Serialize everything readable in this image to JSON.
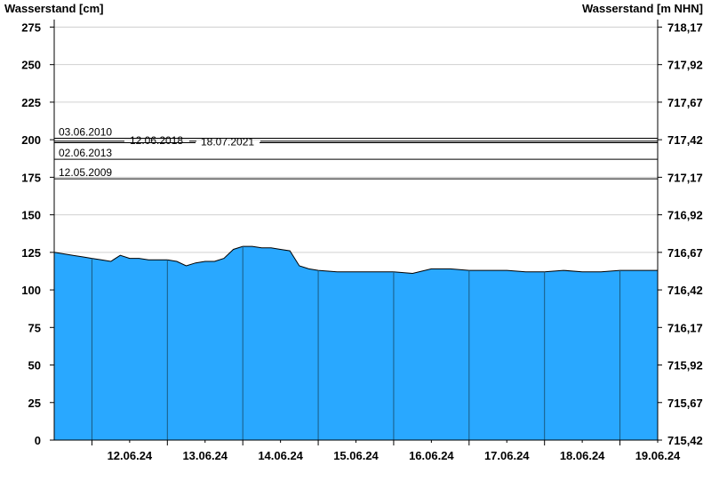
{
  "chart_data": {
    "type": "area",
    "ylabel_left": "Wasserstand [cm]",
    "ylabel_right": "Wasserstand [m NHN]",
    "ylim": [
      0,
      280
    ],
    "y_ticks_left": [
      0,
      25,
      50,
      75,
      100,
      125,
      150,
      175,
      200,
      225,
      250,
      275
    ],
    "y_ticks_right_labels": [
      "715,42",
      "715,67",
      "715,92",
      "716,17",
      "716,42",
      "716,67",
      "716,92",
      "717,17",
      "717,42",
      "717,67",
      "717,92",
      "718,17"
    ],
    "x_range": [
      "11.06.24 12:00",
      "19.06.24 12:00"
    ],
    "x_tick_labels": [
      "12.06.24",
      "13.06.24",
      "14.06.24",
      "15.06.24",
      "16.06.24",
      "17.06.24",
      "18.06.24",
      "19.06.24"
    ],
    "grid": true,
    "fill_color": "#29a8ff",
    "outline_color": "#000000",
    "day_separator_color": "#1a5a80",
    "reference_levels": [
      {
        "label": "03.06.2010",
        "value": 201
      },
      {
        "label": "12.06.2018",
        "value": 199
      },
      {
        "label": "18.07.2021",
        "value": 198
      },
      {
        "label": "02.06.2013",
        "value": 187
      },
      {
        "label": "12.05.2009",
        "value": 174
      }
    ],
    "series": [
      {
        "x": [
          "11.06.24 12:00",
          "11.06.24 15:00",
          "11.06.24 18:00",
          "11.06.24 21:00",
          "12.06.24 00:00",
          "12.06.24 03:00",
          "12.06.24 06:00",
          "12.06.24 09:00",
          "12.06.24 12:00",
          "12.06.24 15:00",
          "12.06.24 18:00",
          "12.06.24 21:00",
          "13.06.24 00:00",
          "13.06.24 03:00",
          "13.06.24 06:00",
          "13.06.24 09:00",
          "13.06.24 12:00",
          "13.06.24 15:00",
          "13.06.24 18:00",
          "13.06.24 21:00",
          "14.06.24 00:00",
          "14.06.24 03:00",
          "14.06.24 06:00",
          "14.06.24 09:00",
          "14.06.24 12:00",
          "14.06.24 15:00",
          "14.06.24 18:00",
          "14.06.24 21:00",
          "15.06.24 00:00",
          "15.06.24 06:00",
          "15.06.24 12:00",
          "15.06.24 18:00",
          "16.06.24 00:00",
          "16.06.24 06:00",
          "16.06.24 12:00",
          "16.06.24 18:00",
          "17.06.24 00:00",
          "17.06.24 06:00",
          "17.06.24 12:00",
          "17.06.24 18:00",
          "18.06.24 00:00",
          "18.06.24 06:00",
          "18.06.24 12:00",
          "18.06.24 18:00",
          "19.06.24 00:00",
          "19.06.24 06:00",
          "19.06.24 12:00"
        ],
        "values": [
          125,
          124,
          123,
          122,
          121,
          120,
          119,
          123,
          121,
          121,
          120,
          120,
          120,
          119,
          116,
          118,
          119,
          119,
          121,
          127,
          129,
          129,
          128,
          128,
          127,
          126,
          116,
          114,
          113,
          112,
          112,
          112,
          112,
          111,
          114,
          114,
          113,
          113,
          113,
          112,
          112,
          113,
          112,
          112,
          113,
          113,
          113
        ]
      }
    ]
  }
}
